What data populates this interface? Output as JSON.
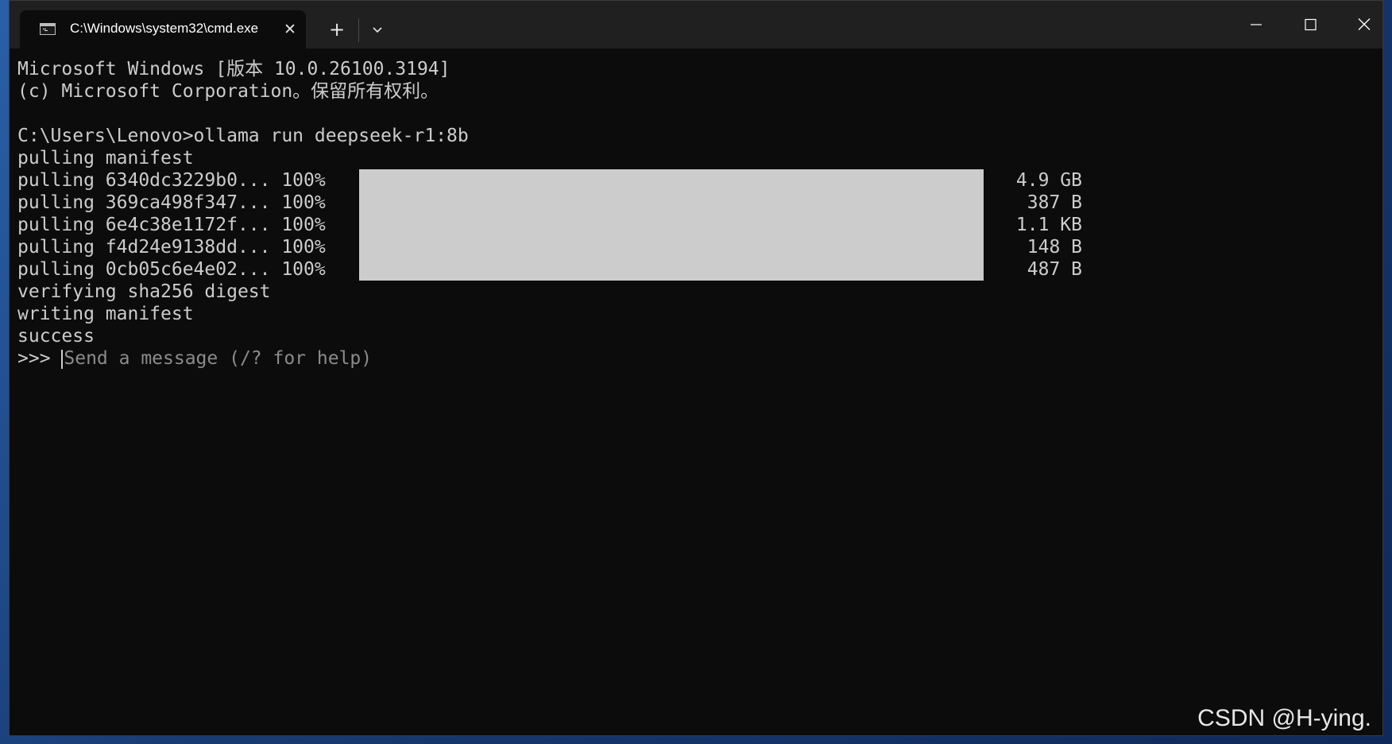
{
  "window": {
    "tab_title": "C:\\Windows\\system32\\cmd.exe",
    "new_tab_glyph": "+",
    "close_glyph": "✕"
  },
  "terminal": {
    "header": [
      "Microsoft Windows [版本 10.0.26100.3194]",
      "(c) Microsoft Corporation。保留所有权利。"
    ],
    "command_line": "C:\\Users\\Lenovo>ollama run deepseek-r1:8b",
    "pulling_manifest": "pulling manifest",
    "layers": [
      {
        "label": "pulling 6340dc3229b0... 100%",
        "size": "4.9 GB",
        "progress": 1.0
      },
      {
        "label": "pulling 369ca498f347... 100%",
        "size": "387 B",
        "progress": 1.0
      },
      {
        "label": "pulling 6e4c38e1172f... 100%",
        "size": "1.1 KB",
        "progress": 1.0
      },
      {
        "label": "pulling f4d24e9138dd... 100%",
        "size": "148 B",
        "progress": 1.0
      },
      {
        "label": "pulling 0cb05c6e4e02... 100%",
        "size": "487 B",
        "progress": 1.0
      }
    ],
    "status_lines": [
      "verifying sha256 digest",
      "writing manifest",
      "success"
    ],
    "prompt": ">>> ",
    "prompt_placeholder": "Send a message (/? for help)"
  },
  "watermark": "CSDN @H-ying."
}
